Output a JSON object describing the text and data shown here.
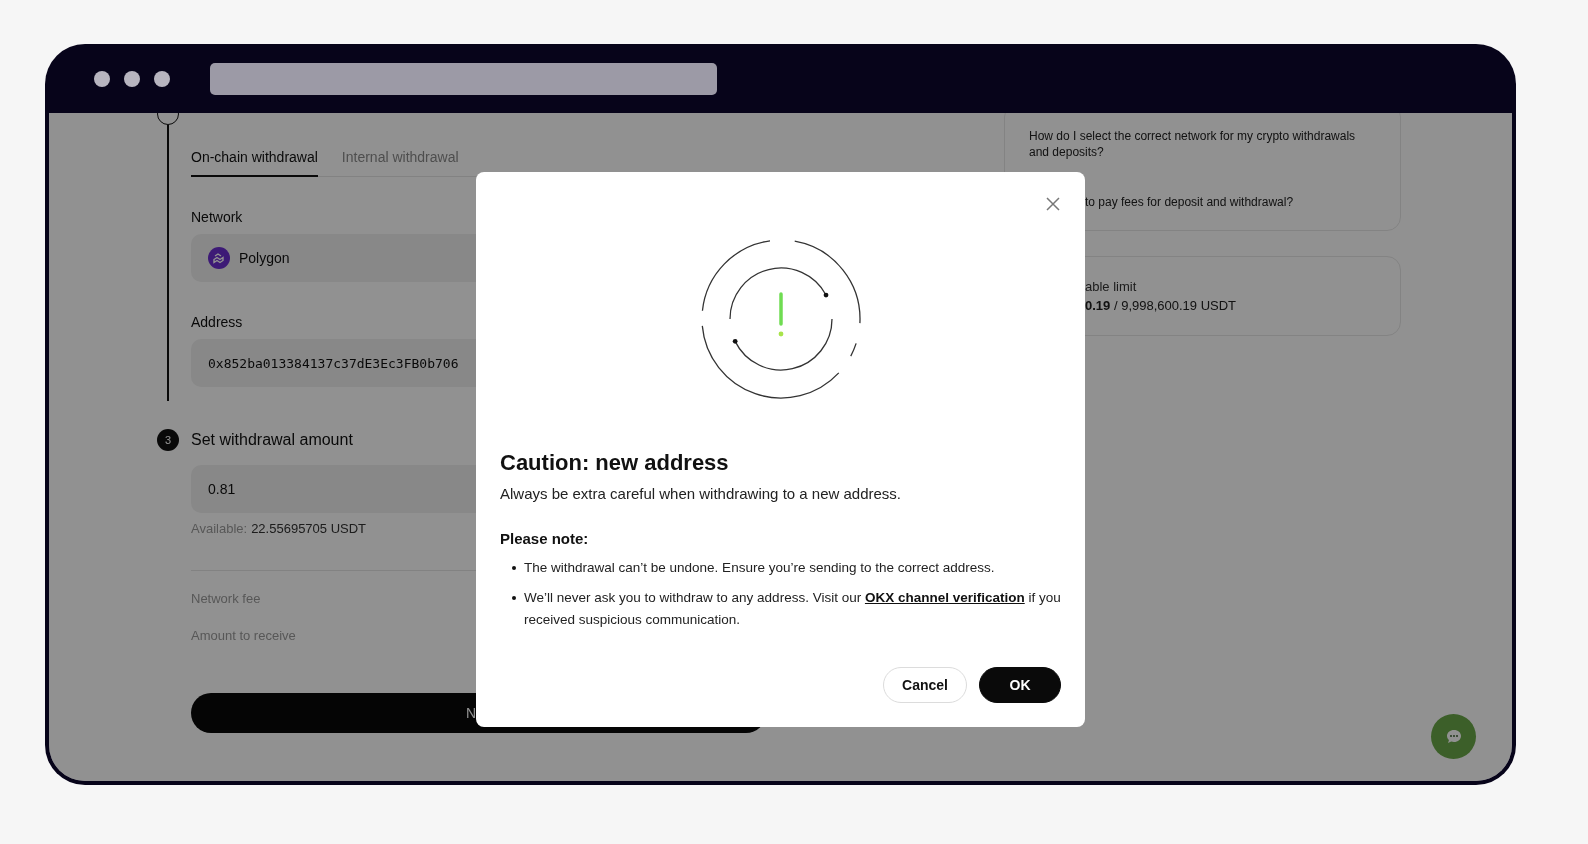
{
  "page": {
    "tabs": [
      {
        "label": "On-chain withdrawal",
        "selected": true
      },
      {
        "label": "Internal withdrawal",
        "selected": false
      }
    ],
    "network": {
      "label": "Network",
      "value": "Polygon"
    },
    "address": {
      "label": "Address",
      "value": "0x852ba013384137c37dE3Ec3FB0b706"
    },
    "amount_step": {
      "number": "3",
      "title": "Set withdrawal amount"
    },
    "amount": {
      "value": "0.81",
      "available_label": "Available:",
      "available_value": "22.55695705 USDT"
    },
    "summary": [
      "Network fee",
      "Amount to receive"
    ],
    "next_button": "N"
  },
  "faq": [
    "How do I select the correct network for my crypto withdrawals and deposits?",
    "to pay fees for deposit and withdrawal?"
  ],
  "limit": {
    "label": "able limit",
    "value": "**0.19** / 9,998,600.19 USDT"
  },
  "dialog": {
    "title": "Caution: new address",
    "subtitle": "Always be extra careful when withdrawing to a new address.",
    "note_heading": "Please note:",
    "notes": [
      {
        "text": "The withdrawal can’t be undone. Ensure you’re sending to the correct address."
      },
      {
        "text": "We’ll never ask you to withdraw to any address. Visit our ",
        "link": "OKX channel verification",
        "after": " if you received suspicious communication."
      }
    ],
    "buttons": [
      {
        "label": "Cancel",
        "kind": "secondary"
      },
      {
        "label": "OK",
        "kind": "primary"
      }
    ]
  }
}
